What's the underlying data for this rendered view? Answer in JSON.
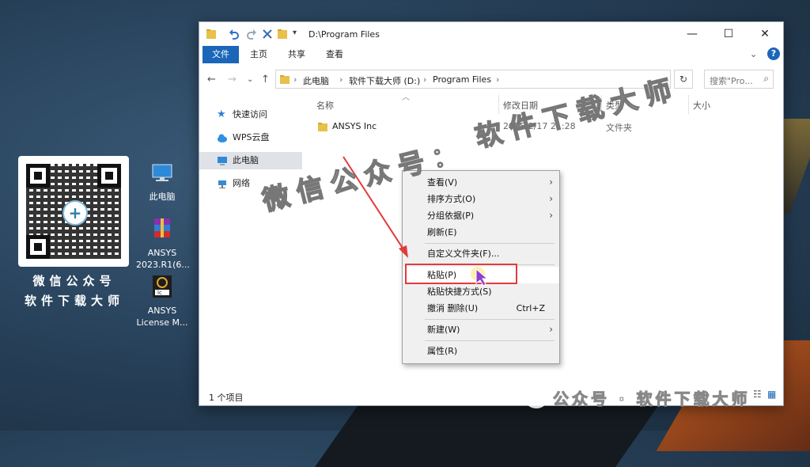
{
  "desktop": {
    "qr_caption_line1": "微信公众号",
    "qr_caption_line2": "软件下载大师",
    "icons": [
      {
        "label": "此电脑"
      },
      {
        "label": "ANSYS 2023.R1(6..."
      },
      {
        "label": "ANSYS License M..."
      }
    ]
  },
  "window": {
    "title_path": "D:\\Program Files",
    "controls": {
      "minimize": "—",
      "maximize": "☐",
      "close": "✕"
    },
    "ribbon_tabs": [
      "文件",
      "主页",
      "共享",
      "查看"
    ],
    "breadcrumb": [
      "此电脑",
      "软件下载大师 (D:)",
      "Program Files"
    ],
    "search_placeholder": "搜索\"Pro...",
    "nav_pane": [
      "快速访问",
      "WPS云盘",
      "此电脑",
      "网络"
    ],
    "columns": [
      "名称",
      "修改日期",
      "类型",
      "大小"
    ],
    "files": [
      {
        "name": "ANSYS Inc",
        "modified": "2025/2/17 21:28",
        "type": "文件夹",
        "size": ""
      }
    ],
    "status": "1 个项目"
  },
  "context_menu": {
    "items": [
      {
        "label": "查看(V)",
        "submenu": true
      },
      {
        "label": "排序方式(O)",
        "submenu": true
      },
      {
        "label": "分组依据(P)",
        "submenu": true
      },
      {
        "label": "刷新(E)"
      },
      {
        "label": "自定义文件夹(F)..."
      },
      {
        "label": "粘贴(P)"
      },
      {
        "label": "粘贴快捷方式(S)"
      },
      {
        "label": "撤消 删除(U)",
        "shortcut": "Ctrl+Z"
      },
      {
        "label": "新建(W)",
        "submenu": true
      },
      {
        "label": "属性(R)"
      }
    ]
  },
  "watermark": {
    "line1": "微信公众号：",
    "line2": "软件下载大师",
    "footer": "公众号 · 软件下载大师"
  },
  "colors": {
    "accent": "#1a66b8",
    "highlight": "#e33b3b",
    "arrow": "#e33b3b"
  }
}
